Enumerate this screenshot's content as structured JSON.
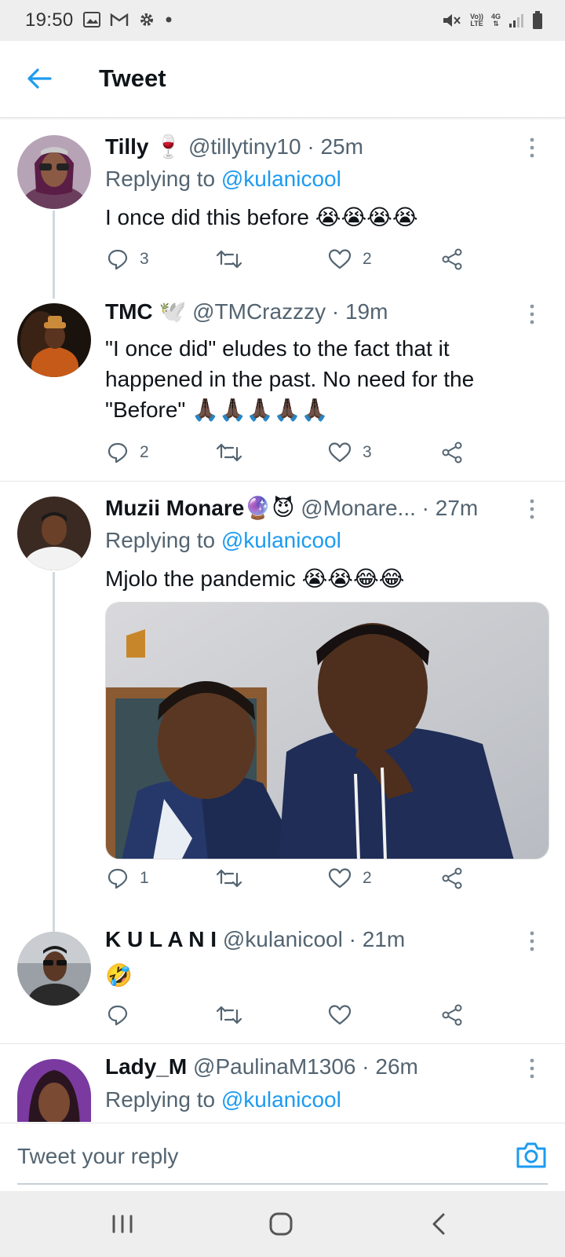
{
  "status_bar": {
    "time": "19:50",
    "volte_top": "Vo))",
    "volte_bottom": "LTE",
    "network_top": "4G",
    "network_bottom": "⇅",
    "icons": [
      "image-icon",
      "gmail-icon",
      "settings-icon",
      "dot-icon",
      "mute-icon",
      "volte-icon",
      "network-icon",
      "signal-icon",
      "battery-icon"
    ]
  },
  "header": {
    "title": "Tweet"
  },
  "tweets": [
    {
      "name": "Tilly",
      "name_emoji": "🍷",
      "handle": "@tillytiny10",
      "dot": "·",
      "time": "25m",
      "replying_prefix": "Replying to",
      "replying_to": "@kulanicool",
      "text": "I once did this before",
      "text_emoji": "😭😭😭😭",
      "replies": "3",
      "likes": "2"
    },
    {
      "name": "TMC",
      "name_emoji": "🕊️",
      "handle": "@TMCrazzzy",
      "dot": "·",
      "time": "19m",
      "text": "\"I once did\" eludes to the fact that it happened in the past. No need for the \"Before\"",
      "text_emoji": "🙏🏿🙏🏿🙏🏿🙏🏿🙏🏿",
      "replies": "2",
      "likes": "3"
    },
    {
      "name": "Muzii Monare",
      "name_emoji": "🔮😈",
      "handle": "@Monare...",
      "dot": "·",
      "time": "27m",
      "replying_prefix": "Replying to",
      "replying_to": "@kulanicool",
      "text": "Mjolo the pandemic",
      "text_emoji": "😭😭😂😂",
      "replies": "1",
      "likes": "2"
    },
    {
      "name": "K U L A N I",
      "handle": "@kulanicool",
      "dot": "·",
      "time": "21m",
      "text_emoji": "🤣",
      "replies": "",
      "likes": ""
    },
    {
      "name": "Lady_M",
      "handle": "@PaulinaM1306",
      "dot": "·",
      "time": "26m",
      "replying_prefix": "Replying to",
      "replying_to": "@kulanicool"
    }
  ],
  "reply_bar": {
    "placeholder": "Tweet your reply"
  },
  "colors": {
    "accent": "#1d9bf0",
    "text_primary": "#0f1419",
    "text_secondary": "#536471",
    "divider": "#e6e6e6",
    "thread_line": "#cfd9de"
  }
}
